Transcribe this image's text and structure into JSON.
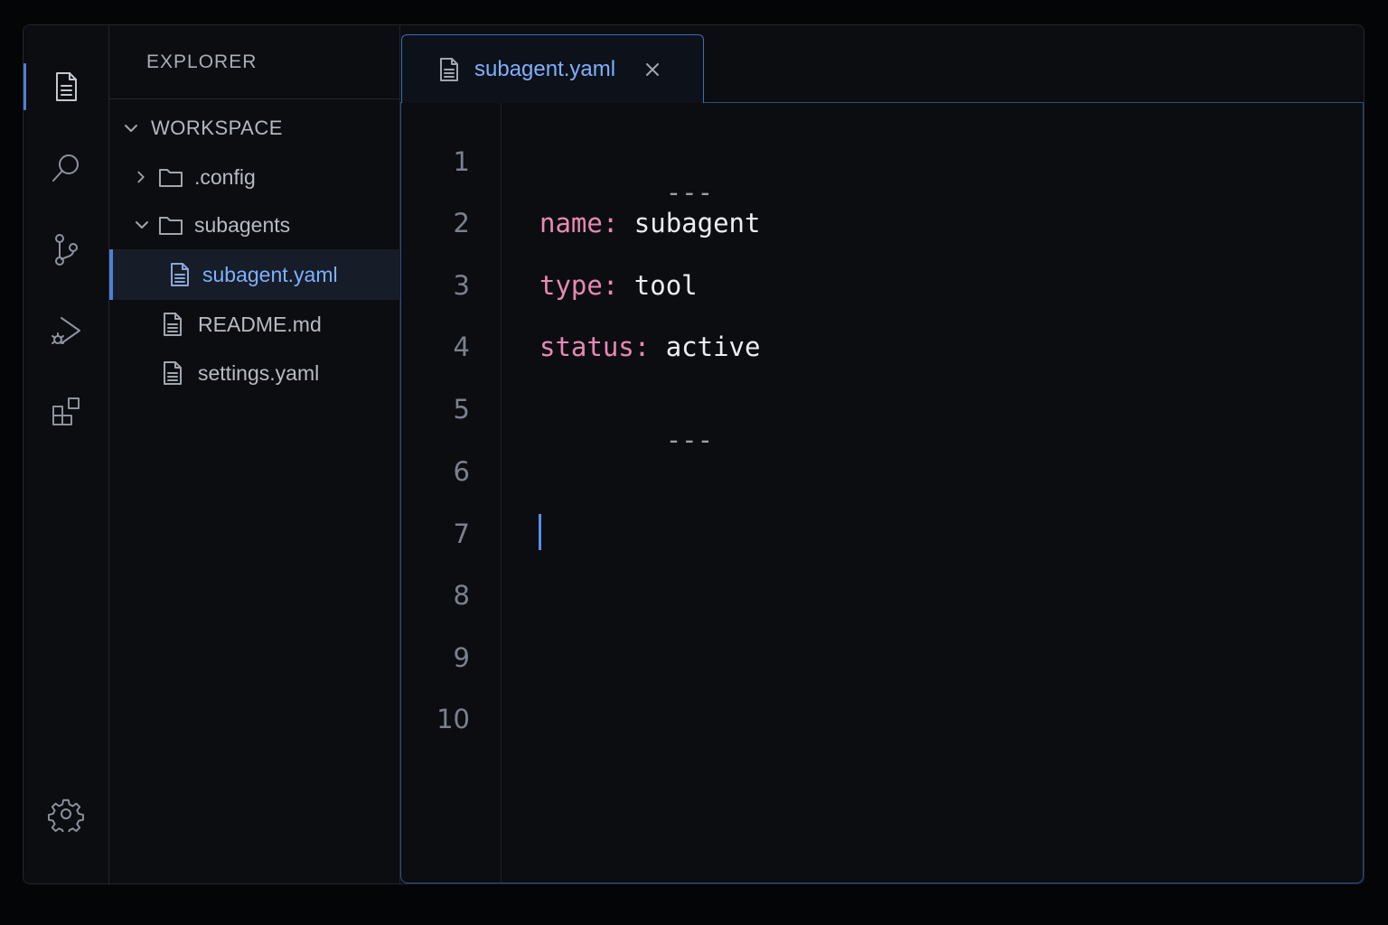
{
  "colors": {
    "background": "#0b0d11",
    "accent": "#4d7fd6",
    "yaml_key": "#e889b3",
    "yaml_value": "#eceef1",
    "selected_text": "#7eb0ff"
  },
  "activity_bar": {
    "items": [
      {
        "icon": "explorer-file-icon",
        "active": true
      },
      {
        "icon": "search-icon"
      },
      {
        "icon": "source-control-branch-icon"
      },
      {
        "icon": "run-debug-icon"
      },
      {
        "icon": "extensions-icon"
      }
    ],
    "bottom_icon": "settings-gear-icon"
  },
  "sidebar": {
    "title": "EXPLORER",
    "workspace": "WORKSPACE",
    "tree": [
      {
        "label": ".config",
        "kind": "folder",
        "expanded": false
      },
      {
        "label": "subagents",
        "kind": "folder",
        "expanded": true
      },
      {
        "label": "subagent.yaml",
        "kind": "file",
        "selected": true
      },
      {
        "label": "README.md",
        "kind": "file"
      },
      {
        "label": "settings.yaml",
        "kind": "file"
      }
    ]
  },
  "editor": {
    "tab": {
      "label": "subagent.yaml"
    },
    "line_numbers": [
      "1",
      "2",
      "3",
      "4",
      "5",
      "6",
      "7",
      "8",
      "9",
      "10"
    ],
    "lines": [
      {
        "dash": "---"
      },
      {
        "key": "name:",
        "value": "subagent"
      },
      {
        "key": "type:",
        "value": "tool"
      },
      {
        "key": "status:",
        "value": "active"
      },
      {
        "dash": "---"
      }
    ],
    "cursor_line": 7
  }
}
